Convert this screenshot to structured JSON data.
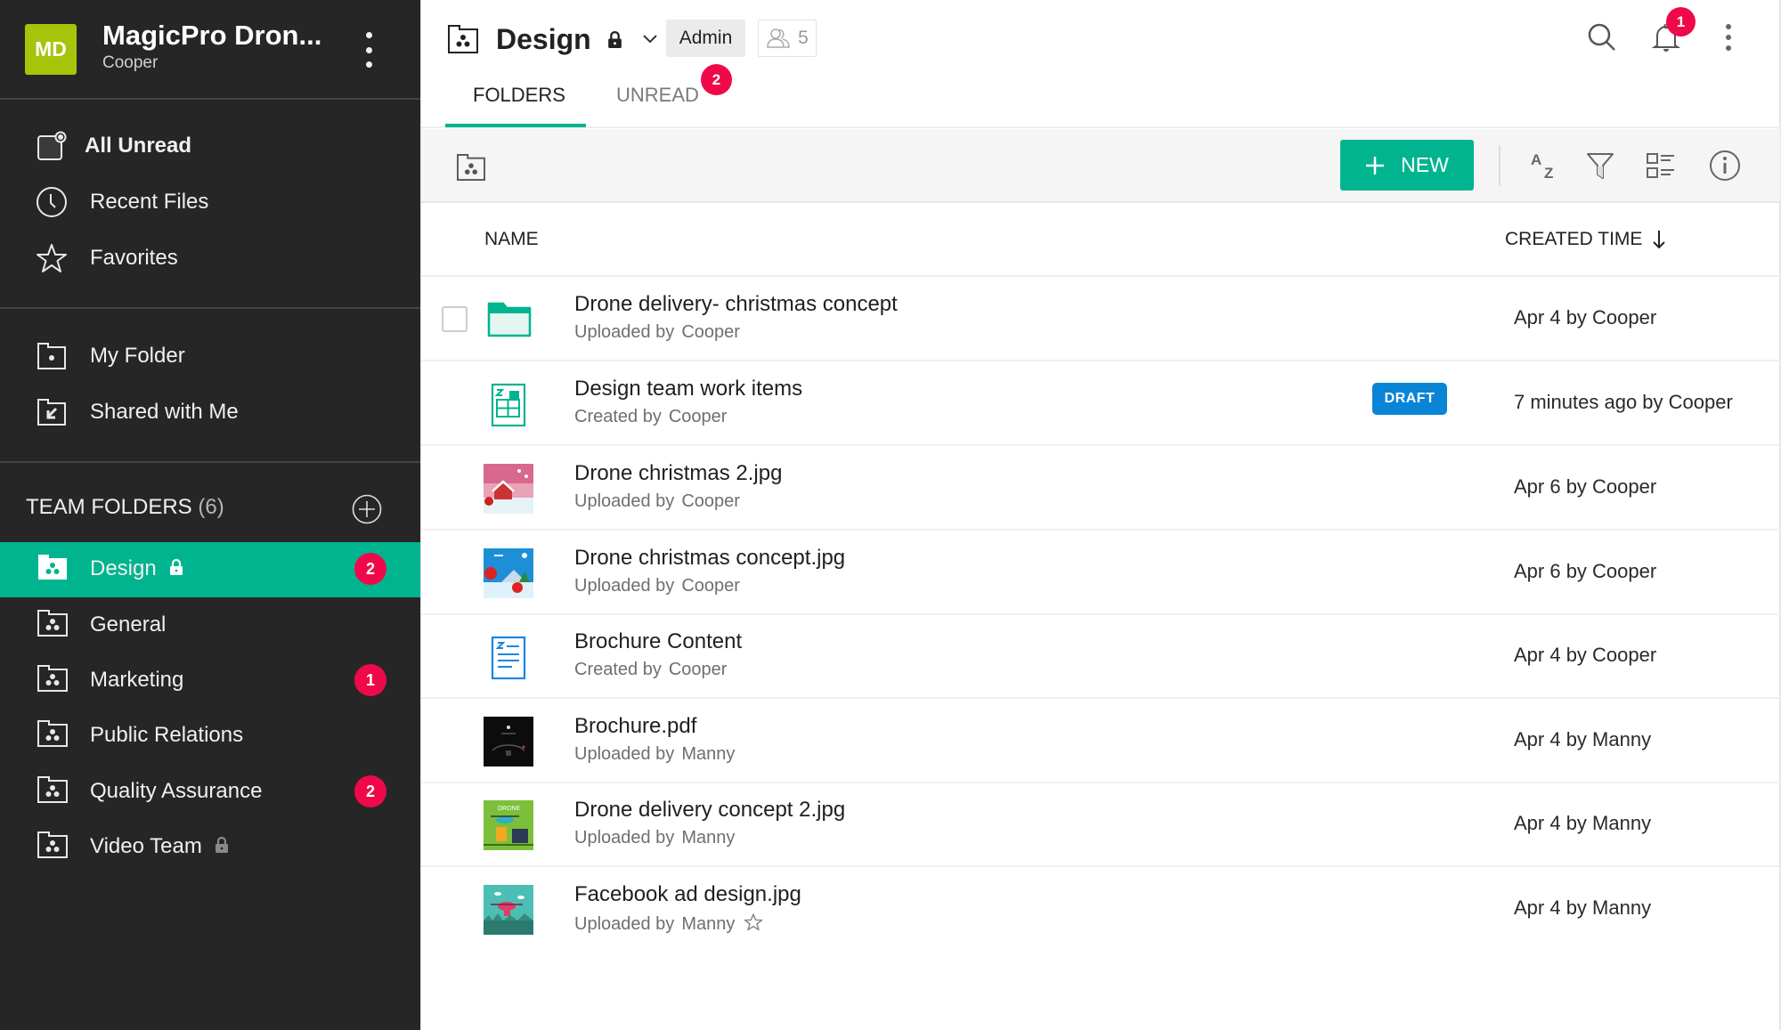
{
  "org": {
    "logo_initials": "MD",
    "name": "MagicPro Dron...",
    "user": "Cooper",
    "logo_color": "#a5c50a"
  },
  "sidebar": {
    "quick_items": [
      {
        "label": "All Unread",
        "icon": "unread-icon"
      },
      {
        "label": "Recent Files",
        "icon": "clock-icon"
      },
      {
        "label": "Favorites",
        "icon": "star-icon"
      }
    ],
    "personal_items": [
      {
        "label": "My Folder",
        "icon": "my-folder-icon"
      },
      {
        "label": "Shared with Me",
        "icon": "shared-folder-icon"
      }
    ],
    "team_folders_label": "TEAM FOLDERS",
    "team_folders_count": "(6)",
    "team_folders": [
      {
        "label": "Design",
        "locked": true,
        "badge": "2",
        "active": true
      },
      {
        "label": "General",
        "locked": false,
        "badge": null,
        "active": false
      },
      {
        "label": "Marketing",
        "locked": false,
        "badge": "1",
        "active": false
      },
      {
        "label": "Public Relations",
        "locked": false,
        "badge": null,
        "active": false
      },
      {
        "label": "Quality Assurance",
        "locked": false,
        "badge": "2",
        "active": false
      },
      {
        "label": "Video Team",
        "locked": true,
        "badge": null,
        "active": false
      }
    ]
  },
  "header": {
    "title": "Design",
    "role": "Admin",
    "member_count": "5",
    "notification_count": "1"
  },
  "tabs": [
    {
      "label": "FOLDERS",
      "active": true
    },
    {
      "label": "UNREAD",
      "active": false,
      "badge": "2"
    }
  ],
  "toolbar": {
    "new_label": "NEW",
    "icons": [
      "sort-az-icon",
      "filter-icon",
      "view-toggle-icon",
      "info-icon"
    ]
  },
  "table": {
    "col_name": "NAME",
    "col_time": "CREATED TIME",
    "sort_direction": "descending",
    "rows": [
      {
        "name": "Drone delivery- christmas concept",
        "action": "Uploaded by",
        "by": "Cooper",
        "time": "Apr 4 by Cooper",
        "type": "folder",
        "badge": null,
        "starred": false
      },
      {
        "name": "Design team work items",
        "action": "Created by",
        "by": "Cooper",
        "time": "7 minutes ago by Cooper",
        "type": "sheet",
        "badge": "DRAFT",
        "starred": false
      },
      {
        "name": "Drone christmas 2.jpg",
        "action": "Uploaded by",
        "by": "Cooper",
        "time": "Apr 6 by Cooper",
        "type": "image-pink",
        "badge": null,
        "starred": false
      },
      {
        "name": "Drone christmas concept.jpg",
        "action": "Uploaded by",
        "by": "Cooper",
        "time": "Apr 6 by Cooper",
        "type": "image-blue",
        "badge": null,
        "starred": false
      },
      {
        "name": "Brochure Content",
        "action": "Created by",
        "by": "Cooper",
        "time": "Apr 4 by Cooper",
        "type": "doc",
        "badge": null,
        "starred": false
      },
      {
        "name": "Brochure.pdf",
        "action": "Uploaded by",
        "by": "Manny",
        "time": "Apr 4 by Manny",
        "type": "pdf-dark",
        "badge": null,
        "starred": false
      },
      {
        "name": "Drone delivery concept 2.jpg",
        "action": "Uploaded by",
        "by": "Manny",
        "time": "Apr 4 by Manny",
        "type": "image-green",
        "badge": null,
        "starred": false
      },
      {
        "name": "Facebook ad design.jpg",
        "action": "Uploaded by",
        "by": "Manny",
        "time": "Apr 4 by Manny",
        "type": "image-teal",
        "badge": null,
        "starred": true
      }
    ]
  },
  "colors": {
    "accent": "#00b48f",
    "badge": "#f0094a",
    "draft": "#0a84d6",
    "sidebar_bg": "#262626"
  }
}
